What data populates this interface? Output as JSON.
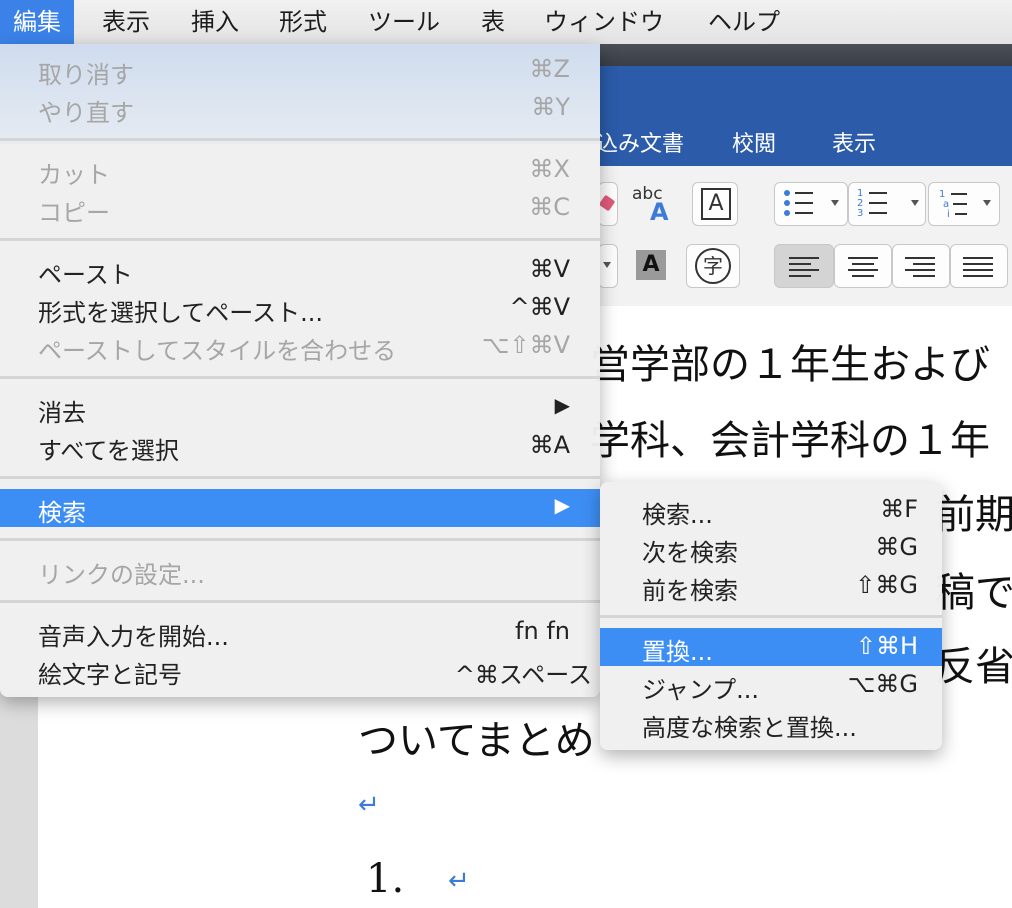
{
  "menubar": {
    "items": [
      "編集",
      "表示",
      "挿入",
      "形式",
      "ツール",
      "表",
      "ウィンドウ",
      "ヘルプ"
    ]
  },
  "ribbon": {
    "tabs": [
      "込み文書",
      "校閲",
      "表示"
    ],
    "icons": {
      "abc": "abc",
      "spell_letter": "A",
      "boxed_a": "A",
      "shaded_a": "A",
      "char_circle": "字"
    }
  },
  "edit_menu": {
    "undo": {
      "label": "取り消す",
      "shortcut": "⌘Z"
    },
    "redo": {
      "label": "やり直す",
      "shortcut": "⌘Y"
    },
    "cut": {
      "label": "カット",
      "shortcut": "⌘X"
    },
    "copy": {
      "label": "コピー",
      "shortcut": "⌘C"
    },
    "paste": {
      "label": "ペースト",
      "shortcut": "⌘V"
    },
    "paste_special": {
      "label": "形式を選択してペースト...",
      "shortcut": "^⌘V"
    },
    "paste_match_style": {
      "label": "ペーストしてスタイルを合わせる",
      "shortcut": "⌥⇧⌘V"
    },
    "clear": {
      "label": "消去",
      "shortcut": "▶"
    },
    "select_all": {
      "label": "すべてを選択",
      "shortcut": "⌘A"
    },
    "find": {
      "label": "検索",
      "shortcut": "▶"
    },
    "link_settings": {
      "label": "リンクの設定..."
    },
    "start_dictation": {
      "label": "音声入力を開始...",
      "shortcut": "fn fn"
    },
    "emoji": {
      "label": "絵文字と記号",
      "shortcut": "^⌘スペース"
    }
  },
  "find_submenu": {
    "find": {
      "label": "検索...",
      "shortcut": "⌘F"
    },
    "find_next": {
      "label": "次を検索",
      "shortcut": "⌘G"
    },
    "find_prev": {
      "label": "前を検索",
      "shortcut": "⇧⌘G"
    },
    "replace": {
      "label": "置換...",
      "shortcut": "⇧⌘H"
    },
    "jump": {
      "label": "ジャンプ...",
      "shortcut": "⌥⌘G"
    },
    "advanced": {
      "label": "高度な検索と置換..."
    }
  },
  "document": {
    "line1": "営学部の１年生および",
    "line2": "学科、会計学科の１年",
    "line3": "前期に",
    "line4": "稿で",
    "line5": "反省",
    "line6": "ついてまとめ",
    "numbered_item": "1.",
    "return_mark": "↵"
  }
}
